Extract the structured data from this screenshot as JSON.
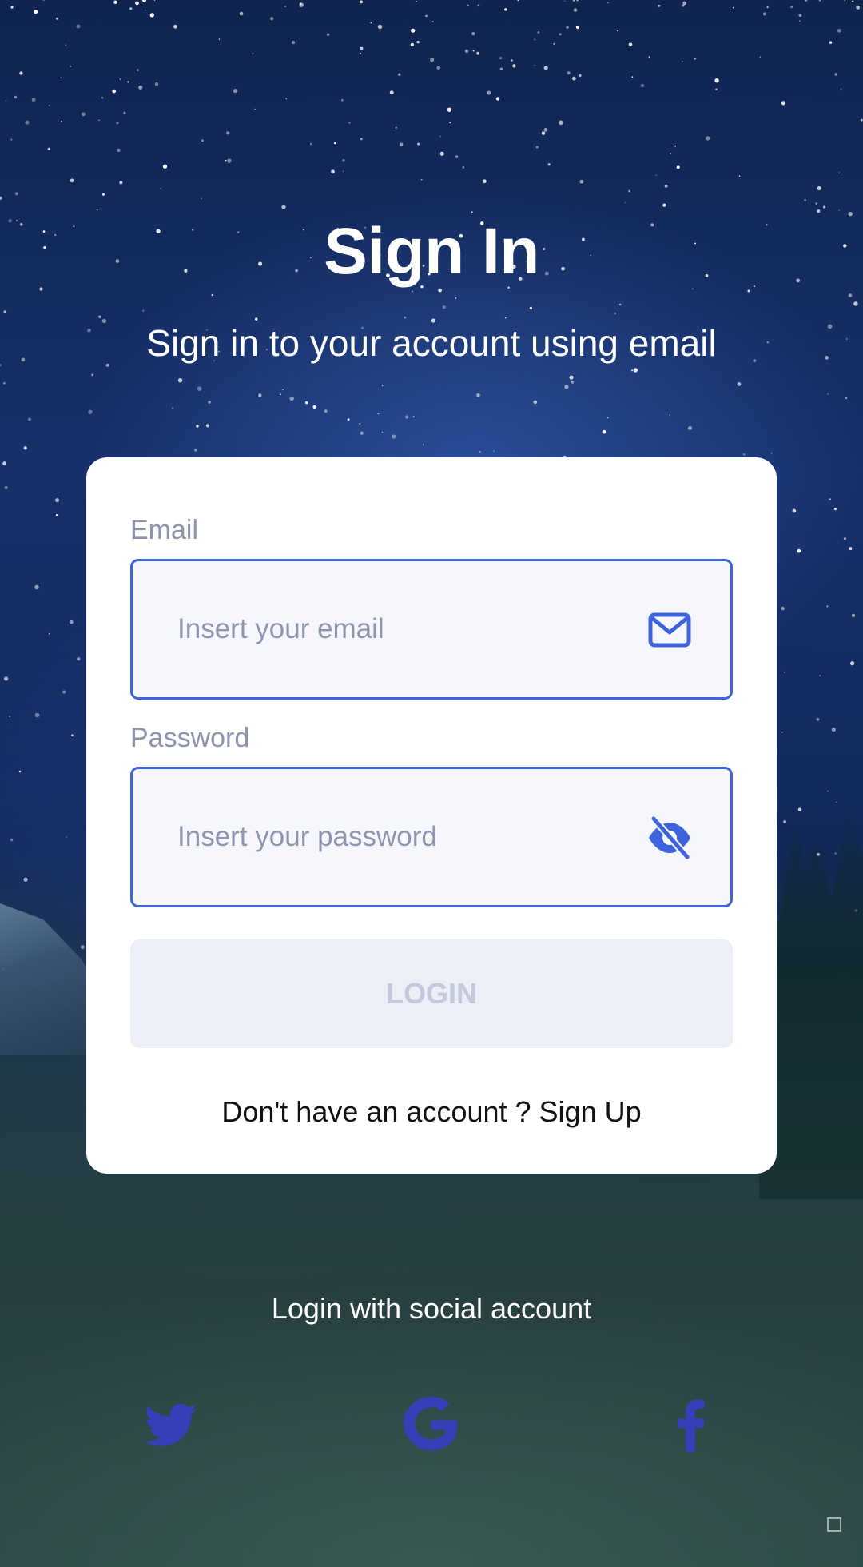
{
  "header": {
    "title": "Sign In",
    "subtitle": "Sign in to your account using email"
  },
  "form": {
    "email": {
      "label": "Email",
      "placeholder": "Insert your email",
      "value": "",
      "icon": "mail-icon"
    },
    "password": {
      "label": "Password",
      "placeholder": "Insert your password",
      "value": "",
      "icon": "eye-off-icon"
    },
    "login_label": "LOGIN",
    "signup_text": "Don't have an account ? Sign Up"
  },
  "social": {
    "title": "Login with social account",
    "providers": [
      "twitter-icon",
      "google-icon",
      "facebook-icon"
    ]
  },
  "colors": {
    "accent": "#3d63dd",
    "social_icon": "#3a3db8",
    "placeholder": "#8f96b0",
    "button_disabled_bg": "#edeff7",
    "button_disabled_text": "#c4c9dc"
  }
}
